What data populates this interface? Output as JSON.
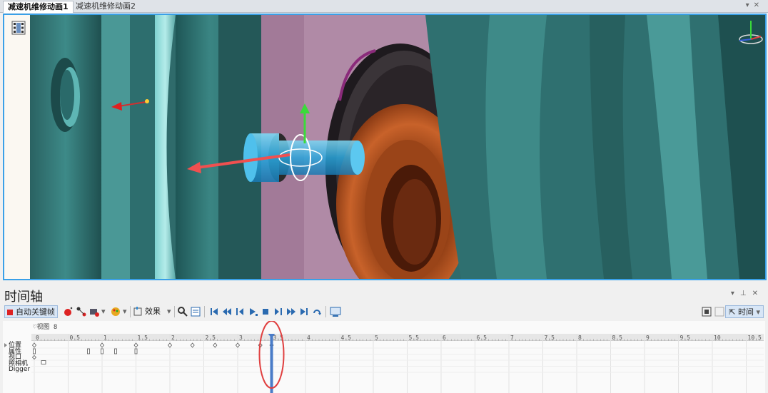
{
  "tabs": [
    {
      "label": "减速机维修动画1",
      "active": true
    },
    {
      "label": "减速机维修动画2",
      "active": false
    }
  ],
  "timeline": {
    "title": "时间轴",
    "view_label": "视图 8",
    "toolbar": {
      "autokey_label": "自动关键帧",
      "effect_label": "效果",
      "time_label": "时间"
    },
    "ruler_ticks": [
      "0",
      "0.5",
      "1",
      "1.5",
      "2",
      "2.5",
      "3",
      "3.5",
      "4",
      "4.5",
      "5",
      "5.5",
      "6",
      "6.5",
      "7",
      "7.5",
      "8",
      "8.5",
      "9",
      "9.5",
      "10",
      "10.5"
    ],
    "tracks": [
      "位置",
      "属性",
      "视口",
      "照相机",
      "Digger"
    ],
    "playhead_time": 3.5,
    "position_keys": [
      0,
      1,
      1.5,
      2,
      2.3333,
      2.6667,
      3.0,
      3.3333,
      3.5
    ],
    "property_keys": [
      0,
      0.8,
      1.0,
      1.2,
      1.5
    ],
    "viewport_keys": [
      0
    ],
    "camera_keys": [
      0
    ],
    "colors": {
      "accent": "#3aa0e8",
      "playhead": "#4a7cc8",
      "highlight_circle": "#e04040"
    }
  }
}
